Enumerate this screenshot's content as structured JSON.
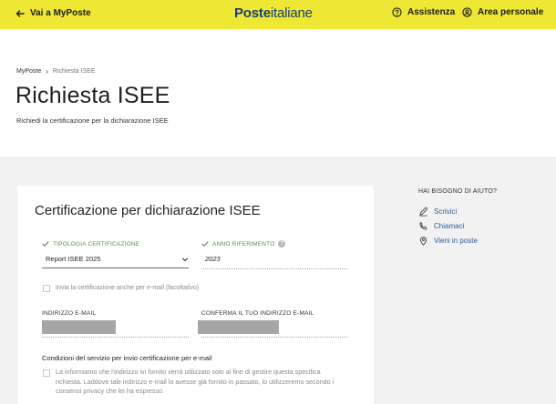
{
  "header": {
    "back_label": "Vai a MyPoste",
    "logo_bold": "Poste",
    "logo_normal": "italiane",
    "assistenza_label": "Assistenza",
    "area_personale_label": "Area personale"
  },
  "breadcrumb": {
    "root": "MyPoste",
    "current": "Richiesta ISEE"
  },
  "page": {
    "title": "Richiesta ISEE",
    "subtitle": "Richiedi la certificazione per la dichiarazione ISEE"
  },
  "form": {
    "title": "Certificazione per dichiarazione ISEE",
    "tipologia_label": "TIPOLOGIA CERTIFICAZIONE",
    "tipologia_value": "Report ISEE 2025",
    "anno_label": "ANNO RIFERIMENTO",
    "anno_value": "2023",
    "email_checkbox_label": "Invia la certificazione anche per e-mail (facoltativo)",
    "email_label": "INDIRIZZO E-MAIL",
    "confirm_email_label": "CONFERMA IL TUO INDIRIZZO E-MAIL",
    "conditions_heading": "Condizioni del servizio per invio certificazione per e-mail",
    "conditions_text": "La informiamo che l'indirizzo ivi fornito verrà utilizzato solo al fine di gestire questa specifica richiesta. Laddove tale indirizzo e-mail lo avesse già fornito in passato, lo utilizzeremo secondo i consensi privacy che lei ha espresso."
  },
  "help": {
    "title": "HAI BISOGNO DI AIUTO?",
    "items": [
      {
        "label": "Scrivici",
        "icon": "pencil-icon"
      },
      {
        "label": "Chiamaci",
        "icon": "phone-icon"
      },
      {
        "label": "Vieni in poste",
        "icon": "map-pin-icon"
      }
    ]
  },
  "colors": {
    "topbar": "#eee835",
    "logo": "#173d7a",
    "valid_green": "#5a8a4e",
    "link_blue": "#2c5d9b",
    "grey_bg": "#f2f2f2"
  }
}
